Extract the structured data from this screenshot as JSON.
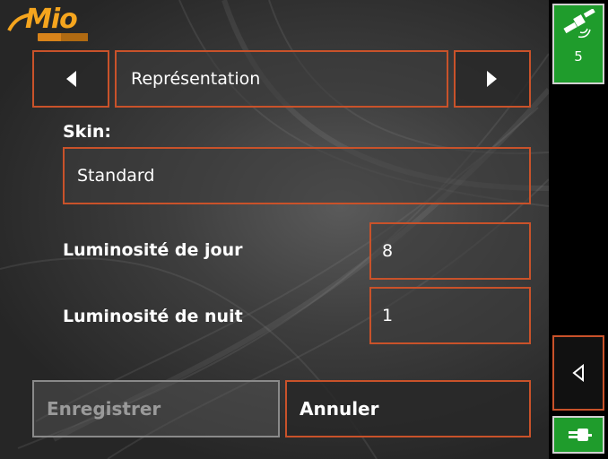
{
  "brand": {
    "logo_text": "Mio"
  },
  "header": {
    "prev_icon": "triangle-left-icon",
    "title": "Représentation",
    "next_icon": "triangle-right-icon"
  },
  "skin": {
    "label": "Skin:",
    "value": "Standard"
  },
  "settings": [
    {
      "label": "Luminosité de jour",
      "value": "8"
    },
    {
      "label": "Luminosité de nuit",
      "value": "1"
    }
  ],
  "actions": {
    "save_label": "Enregistrer",
    "cancel_label": "Annuler"
  },
  "sidebar": {
    "satellite_count": "5",
    "satellite_icon": "satellite-icon",
    "back_icon": "triangle-left-outline-icon",
    "power_icon": "plug-icon"
  },
  "colors": {
    "accent_border": "#c9522a",
    "gps_green": "#1f9c2c",
    "logo_orange": "#f5a51e"
  }
}
